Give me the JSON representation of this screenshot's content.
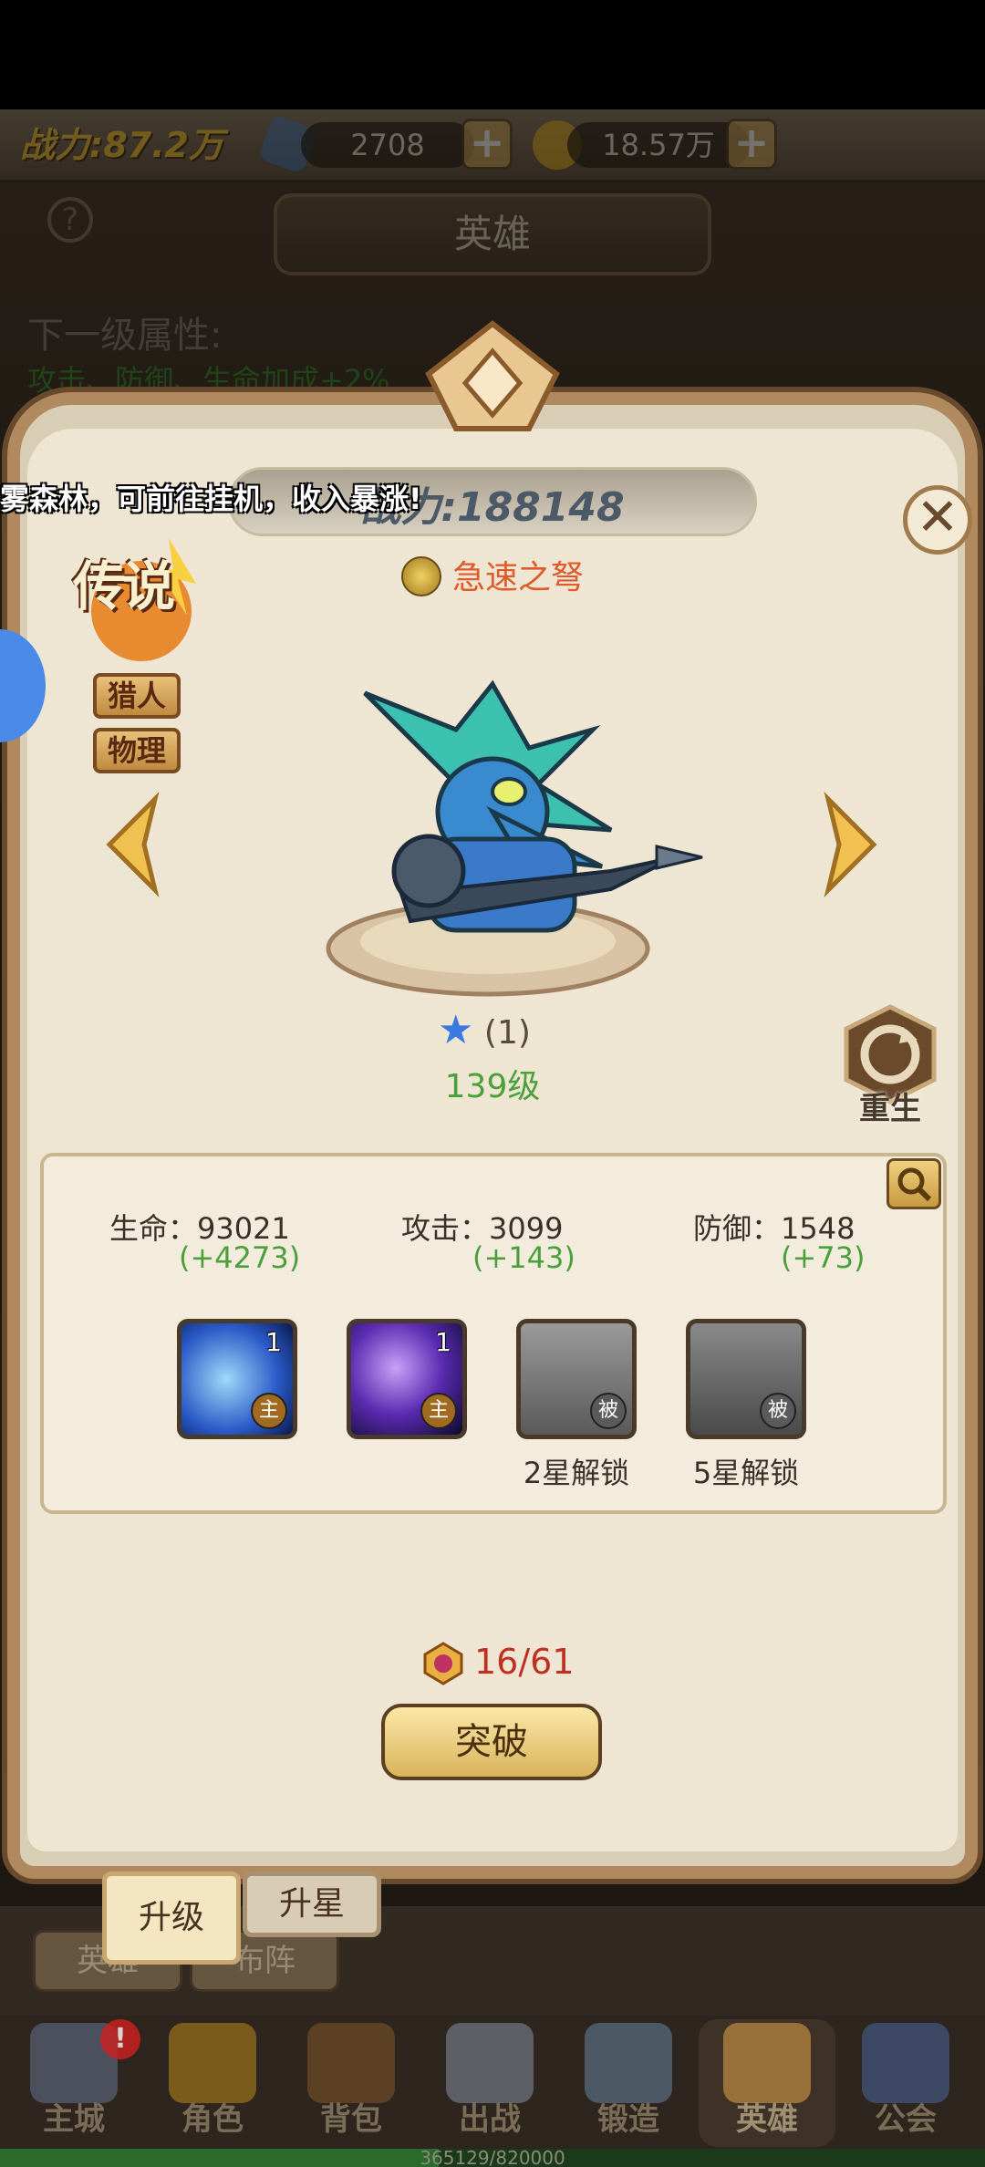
{
  "topbar": {
    "power": "战力:87.2万",
    "gems": "2708",
    "gold": "18.57万"
  },
  "header": {
    "title": "英雄",
    "next_level_title": "下一级属性:",
    "next_level_value": "攻击、防御、生命加成+2%"
  },
  "marquee": "雾森林，可前往挂机，收入暴涨!",
  "hero": {
    "power_label": "战力",
    "power": "188148",
    "skill_name": "急速之弩",
    "rarity": "传说",
    "tags": [
      "猎人",
      "物理"
    ],
    "stars": "(1)",
    "level": "139级",
    "rebirth": "重生"
  },
  "stats": [
    {
      "label": "生命：93021",
      "inc": "(+4273)"
    },
    {
      "label": "攻击：3099",
      "inc": "(+143)"
    },
    {
      "label": "防御：1548",
      "inc": "(+73)"
    }
  ],
  "skills": [
    {
      "count": "1",
      "badge": "主",
      "unlock": ""
    },
    {
      "count": "1",
      "badge": "主",
      "unlock": ""
    },
    {
      "count": "",
      "badge": "被",
      "unlock": "2星解锁"
    },
    {
      "count": "",
      "badge": "被",
      "unlock": "5星解锁"
    }
  ],
  "breakthrough": {
    "count": "16/61",
    "button": "突破"
  },
  "tabs": [
    "升级",
    "升星"
  ],
  "subtabs": [
    "英雄",
    "布阵"
  ],
  "nav": [
    "主城",
    "角色",
    "背包",
    "出战",
    "锻造",
    "英雄",
    "公会"
  ],
  "xp": {
    "text": "365129/820000",
    "progress": 0.445
  },
  "colors": {
    "accent": "#b08a5e",
    "green": "#4aa03a",
    "red": "#c03020"
  }
}
